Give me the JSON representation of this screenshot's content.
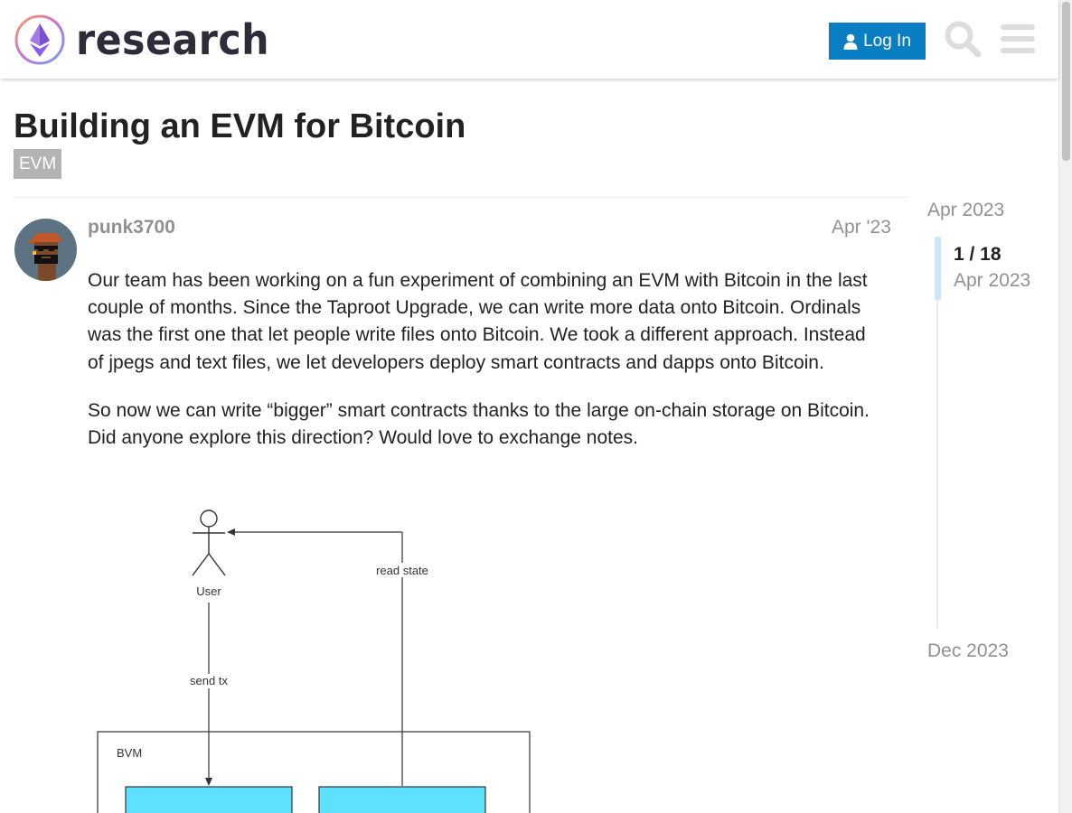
{
  "header": {
    "site_name": "research",
    "login_label": "Log In",
    "search_icon": "search-icon",
    "menu_icon": "hamburger-menu-icon",
    "colors": {
      "login_bg": "#0a7ec2",
      "icon": "#dddddd"
    }
  },
  "topic": {
    "title": "Building an EVM for Bitcoin",
    "tag": "EVM"
  },
  "post": {
    "username": "punk3700",
    "date": "Apr '23",
    "paragraphs": [
      "Our team has been working on a fun experiment of combining an EVM with Bitcoin in the last couple of months. Since the Taproot Upgrade, we can write more data onto Bitcoin. Ordinals was the first one that let people write files onto Bitcoin. We took a different approach. Instead of jpegs and text files, we let developers deploy smart contracts and dapps onto Bitcoin.",
      "So now we can write “bigger” smart contracts thanks to the large on-chain storage on Bitcoin. Did anyone explore this direction? Would love to exchange notes."
    ],
    "diagram": {
      "actor_label": "User",
      "read_label": "read state",
      "send_label": "send tx",
      "box_label": "BVM",
      "block_color": "#5ee0ff"
    }
  },
  "timeline": {
    "start_label": "Apr 2023",
    "position": "1 / 18",
    "position_date": "Apr 2023",
    "end_label": "Dec 2023"
  }
}
